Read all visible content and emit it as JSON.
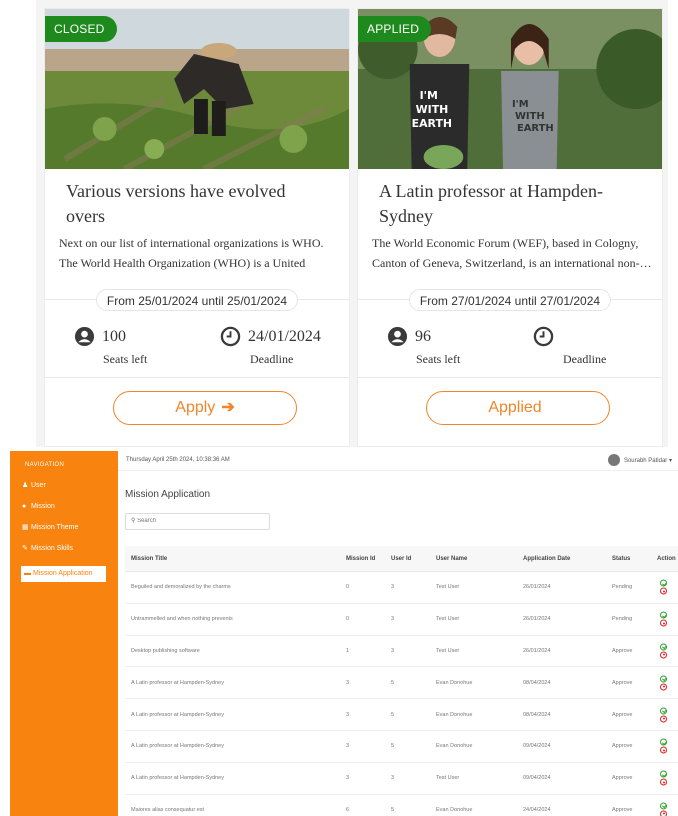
{
  "cards": [
    {
      "badge": "CLOSED",
      "title": "Various versions have evolved overs",
      "description": "Next on our list of international organizations is WHO. The World Health Organization (WHO) is a United Nations…",
      "date_range": "From 25/01/2024 until 25/01/2024",
      "seats": "100",
      "seats_label": "Seats left",
      "deadline": "24/01/2024",
      "deadline_label": "Deadline",
      "button_label": "Apply",
      "button_arrow": "➔"
    },
    {
      "badge": "APPLIED",
      "title": "A Latin professor at Hampden-Sydney",
      "description": "The World Economic Forum (WEF), based in Cologny, Canton of Geneva, Switzerland, is an international non-…",
      "date_range": "From 27/01/2024 until 27/01/2024",
      "seats": "96",
      "seats_label": "Seats left",
      "deadline": "",
      "deadline_label": "Deadline",
      "button_label": "Applied",
      "button_arrow": ""
    }
  ],
  "admin": {
    "nav_title": "NAVIGATION",
    "nav_items": [
      {
        "label": "User",
        "icon": "user-icon",
        "glyph": "♟"
      },
      {
        "label": "Mission",
        "icon": "mission-icon",
        "glyph": "●"
      },
      {
        "label": "Mission Theme",
        "icon": "theme-icon",
        "glyph": "▦"
      },
      {
        "label": "Mission Skills",
        "icon": "wrench-icon",
        "glyph": "✎"
      },
      {
        "label": "Mission Application",
        "icon": "folder-icon",
        "glyph": "▬"
      }
    ],
    "datetime": "Thursday April 25th 2024, 10:38:36 AM",
    "user_name": "Sourabh Patidar",
    "user_caret": "▾",
    "page_title": "Mission Application",
    "search_placeholder": "Search",
    "search_glyph": "⚲",
    "columns": [
      "Mission Title",
      "Mission Id",
      "User Id",
      "User Name",
      "Application Date",
      "Status",
      "Action"
    ],
    "rows": [
      [
        "Beguiled and demoralized by the charms",
        "0",
        "3",
        "Test User",
        "26/01/2024",
        "Pending"
      ],
      [
        "Untrammelled and when nothing prevents",
        "0",
        "3",
        "Test User",
        "26/01/2024",
        "Pending"
      ],
      [
        "Desktop publishing software",
        "1",
        "3",
        "Test User",
        "26/01/2024",
        "Approve"
      ],
      [
        "A Latin professor at Hampden-Sydney",
        "3",
        "5",
        "Evan Donohue",
        "08/04/2024",
        "Approve"
      ],
      [
        "A Latin professor at Hampden-Sydney",
        "3",
        "5",
        "Evan Donohue",
        "08/04/2024",
        "Approve"
      ],
      [
        "A Latin professor at Hampden-Sydney",
        "3",
        "5",
        "Evan Donohue",
        "09/04/2024",
        "Approve"
      ],
      [
        "A Latin professor at Hampden-Sydney",
        "3",
        "3",
        "Test User",
        "09/04/2024",
        "Approve"
      ],
      [
        "Maiores alias consequatur est",
        "6",
        "5",
        "Evan Donohue",
        "24/04/2024",
        "Approve"
      ]
    ]
  },
  "colors": {
    "accent": "#f0862a",
    "sidebar": "#f8830e",
    "badge": "#1e8a1e",
    "approve_icon": "#2aa32a",
    "reject_icon": "#e02020"
  }
}
